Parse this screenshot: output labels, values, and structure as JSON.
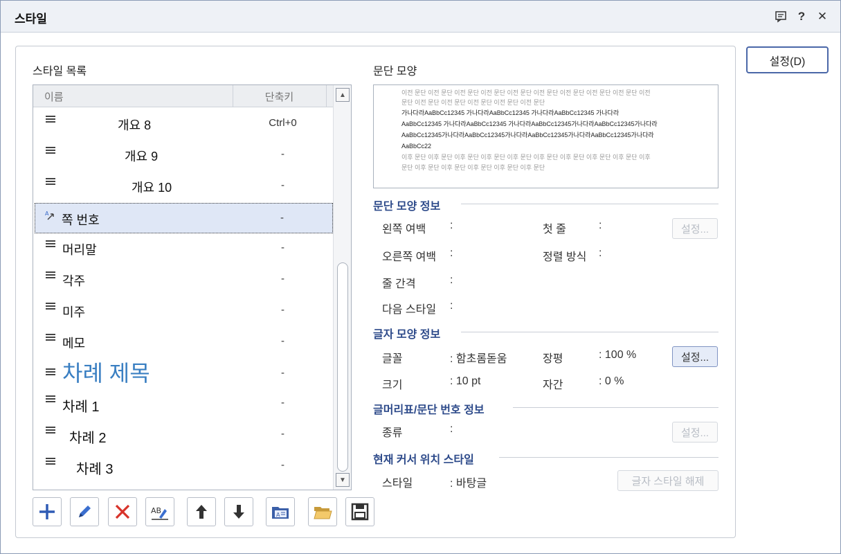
{
  "window": {
    "title": "스타일"
  },
  "sections": {
    "style_list_label": "스타일 목록",
    "paragraph_shape_label": "문단 모양"
  },
  "list": {
    "headers": {
      "name": "이름",
      "shortcut": "단축키"
    },
    "rows": [
      {
        "name": "개요 8",
        "shortcut": "Ctrl+0"
      },
      {
        "name": "개요 9",
        "shortcut": "-"
      },
      {
        "name": "개요 10",
        "shortcut": "-"
      },
      {
        "name": "쪽 번호",
        "shortcut": "-"
      },
      {
        "name": "머리말",
        "shortcut": "-"
      },
      {
        "name": "각주",
        "shortcut": "-"
      },
      {
        "name": "미주",
        "shortcut": "-"
      },
      {
        "name": "메모",
        "shortcut": "-"
      },
      {
        "name": "차례 제목",
        "shortcut": "-"
      },
      {
        "name": "차례 1",
        "shortcut": "-"
      },
      {
        "name": "차례 2",
        "shortcut": "-"
      },
      {
        "name": "차례 3",
        "shortcut": "-"
      }
    ]
  },
  "preview": {
    "lines": [
      "이전 문단 이전 문단 이전 문단 이전 문단 이전 문단 이전 문단 이전 문단 이전 문단 이전 문단 이전",
      "문단 이전 문단 이전 문단 이전 문단 이전 문단 이전 문단",
      "가나다라AaBbCc12345        가나다라AaBbCc12345        가나다라AaBbCc12345        가나다라",
      "AaBbCc12345   가나다라AaBbCc12345   가나다라AaBbCc12345가나다라AaBbCc12345가나다라",
      "AaBbCc12345가나다라AaBbCc12345가나다라AaBbCc12345가나다라AaBbCc12345가나다라",
      "AaBbCc22",
      "이후 문단 이후 문단 이후 문단 이후 문단 이후 문단 이후 문단 이후 문단 이후 문단 이후 문단 이후",
      "문단 이후 문단 이후 문단 이후 문단 이후 문단 이후 문단"
    ]
  },
  "para_info": {
    "title": "문단 모양 정보",
    "left_margin": "왼쪽 여백",
    "first_line": "첫 줄",
    "right_margin": "오른쪽 여백",
    "alignment": "정렬 방식",
    "line_spacing": "줄 간격",
    "next_style": "다음 스타일",
    "colon": ":",
    "button": "설정..."
  },
  "char_info": {
    "title": "글자 모양 정보",
    "font_label": "글꼴",
    "font_value": ": 함초롬돋움",
    "width_label": "장평",
    "width_value": ": 100 %",
    "size_label": "크기",
    "size_value": ": 10 pt",
    "spacing_label": "자간",
    "spacing_value": ": 0 %",
    "button": "설정..."
  },
  "bullet_info": {
    "title": "글머리표/문단 번호 정보",
    "type_label": "종류",
    "colon": ":",
    "button": "설정..."
  },
  "cursor_info": {
    "title": "현재 커서 위치 스타일",
    "style_label": "스타일",
    "style_value": ": 바탕글",
    "button": "글자 스타일 해제"
  },
  "setting_button": "설정(D)",
  "colors": {
    "accent": "#2d4a8a",
    "selection": "#dfe7f6",
    "heading_blue": "#3a7fc2",
    "delete_red": "#d8332a"
  }
}
